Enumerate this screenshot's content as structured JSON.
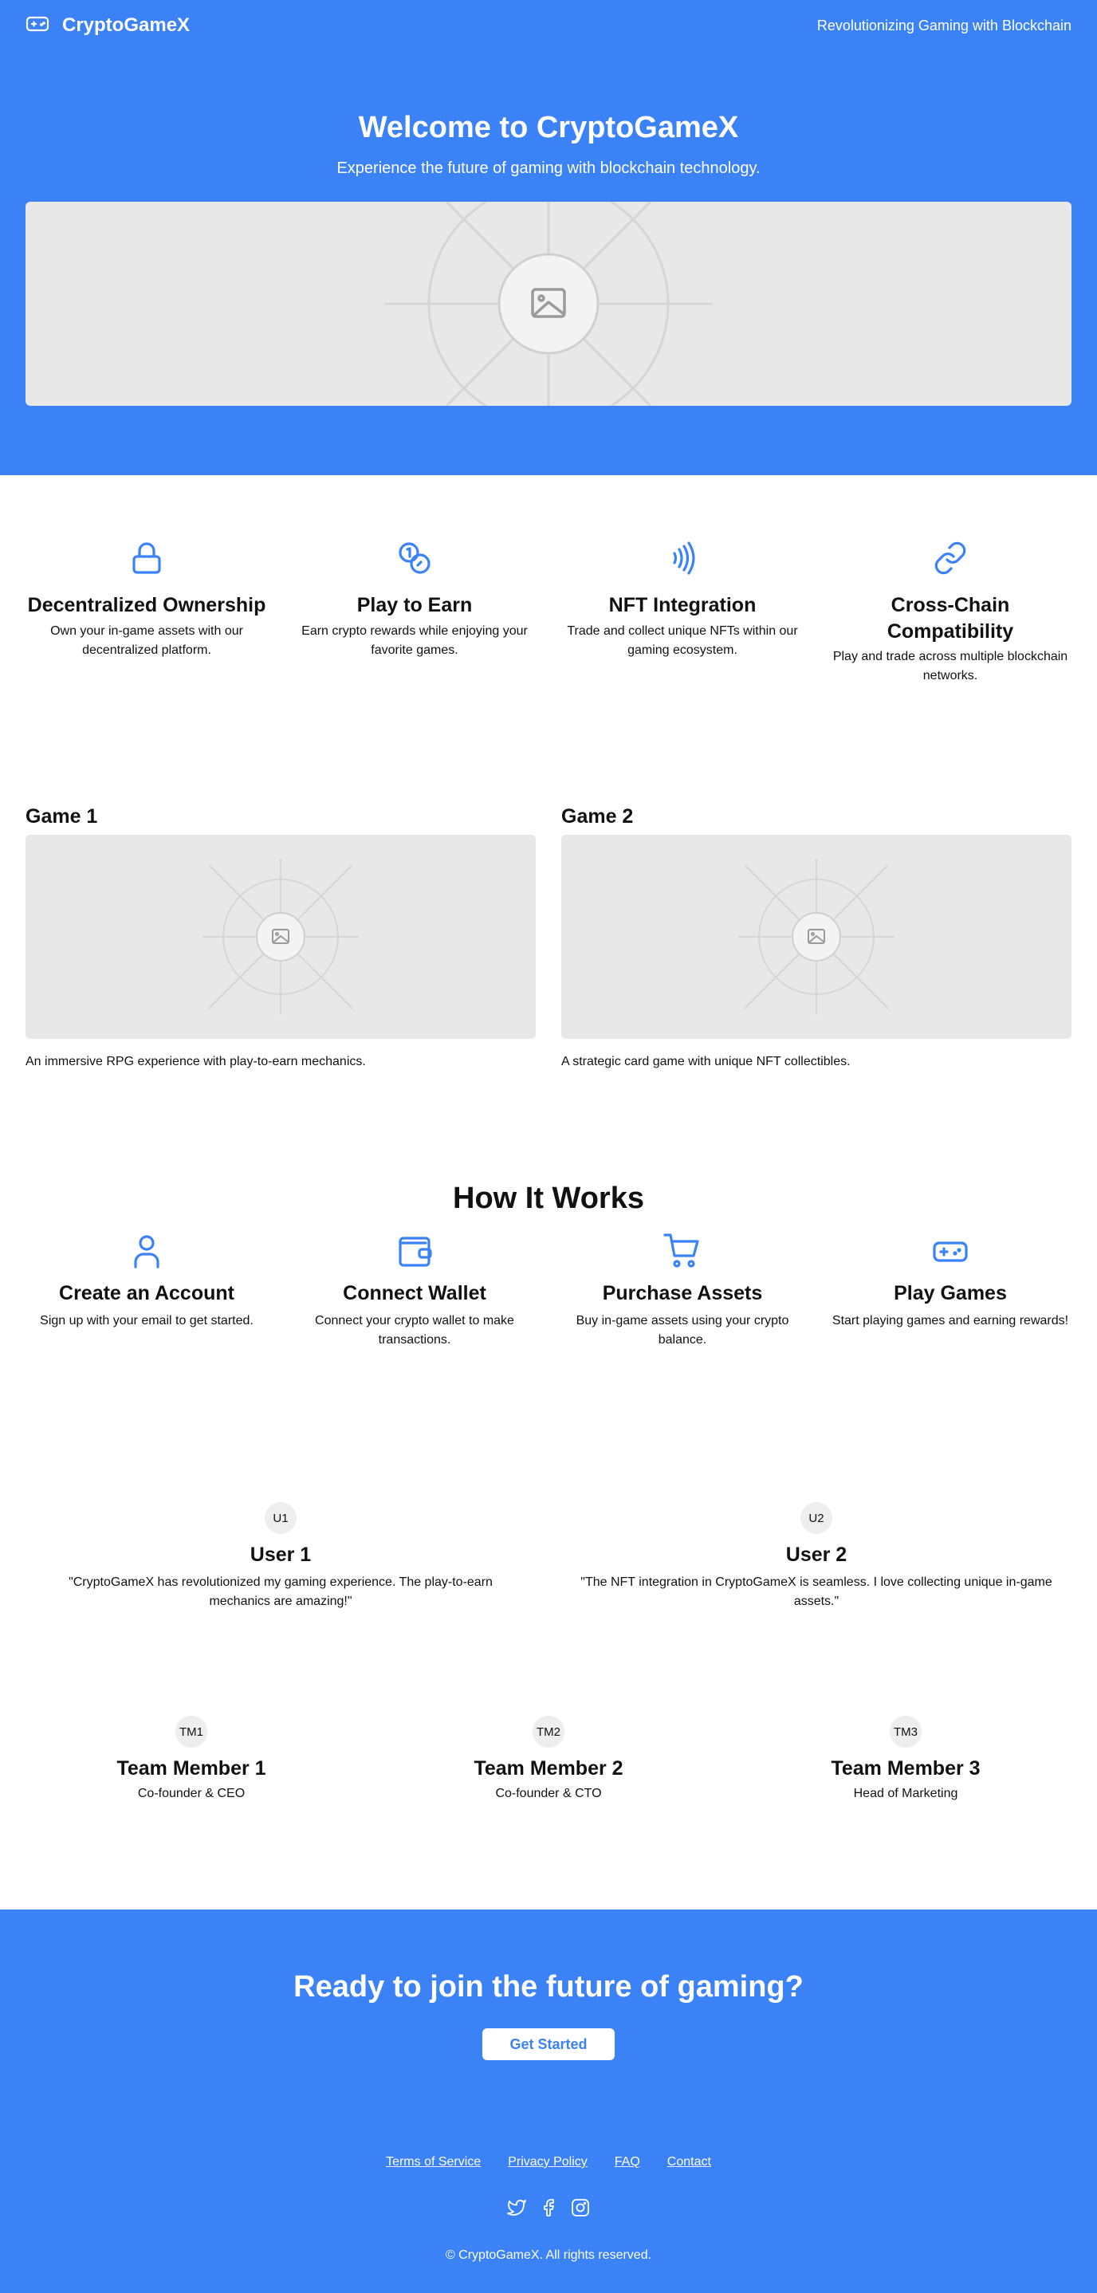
{
  "header": {
    "brand": "CryptoGameX",
    "tagline": "Revolutionizing Gaming with Blockchain",
    "logo_icon": "gamepad-icon"
  },
  "hero": {
    "title": "Welcome to CryptoGameX",
    "subtitle": "Experience the future of gaming with blockchain technology.",
    "image_icon": "image-placeholder-icon"
  },
  "features": [
    {
      "icon": "lock-icon",
      "title": "Decentralized Ownership",
      "text": "Own your in-game assets with our decentralized platform."
    },
    {
      "icon": "coins-icon",
      "title": "Play to Earn",
      "text": "Earn crypto rewards while enjoying your favorite games."
    },
    {
      "icon": "nfc-icon",
      "title": "NFT Integration",
      "text": "Trade and collect unique NFTs within our gaming ecosystem."
    },
    {
      "icon": "link-icon",
      "title": "Cross-Chain Compatibility",
      "text": "Play and trade across multiple blockchain networks."
    }
  ],
  "games": [
    {
      "title": "Game 1",
      "text": "An immersive RPG experience with play-to-earn mechanics."
    },
    {
      "title": "Game 2",
      "text": "A strategic card game with unique NFT collectibles."
    }
  ],
  "how": {
    "title": "How It Works",
    "steps": [
      {
        "icon": "user-icon",
        "title": "Create an Account",
        "text": "Sign up with your email to get started."
      },
      {
        "icon": "wallet-icon",
        "title": "Connect Wallet",
        "text": "Connect your crypto wallet to make transactions."
      },
      {
        "icon": "cart-icon",
        "title": "Purchase Assets",
        "text": "Buy in-game assets using your crypto balance."
      },
      {
        "icon": "gamepad-icon",
        "title": "Play Games",
        "text": "Start playing games and earning rewards!"
      }
    ]
  },
  "testimonials": [
    {
      "avatar": "U1",
      "name": "User 1",
      "quote": "\"CryptoGameX has revolutionized my gaming experience. The play-to-earn mechanics are amazing!\""
    },
    {
      "avatar": "U2",
      "name": "User 2",
      "quote": "\"The NFT integration in CryptoGameX is seamless. I love collecting unique in-game assets.\""
    }
  ],
  "team": [
    {
      "avatar": "TM1",
      "name": "Team Member 1",
      "role": "Co-founder & CEO"
    },
    {
      "avatar": "TM2",
      "name": "Team Member 2",
      "role": "Co-founder & CTO"
    },
    {
      "avatar": "TM3",
      "name": "Team Member 3",
      "role": "Head of Marketing"
    }
  ],
  "cta": {
    "title": "Ready to join the future of gaming?",
    "button": "Get Started"
  },
  "footer": {
    "links": [
      "Terms of Service",
      "Privacy Policy",
      "FAQ",
      "Contact"
    ],
    "socials": [
      "twitter-icon",
      "facebook-icon",
      "instagram-icon"
    ],
    "copyright": "© CryptoGameX. All rights reserved."
  },
  "colors": {
    "primary": "#3b82f6",
    "placeholder_bg": "#e8e8e8",
    "text": "#111111",
    "white": "#ffffff"
  }
}
